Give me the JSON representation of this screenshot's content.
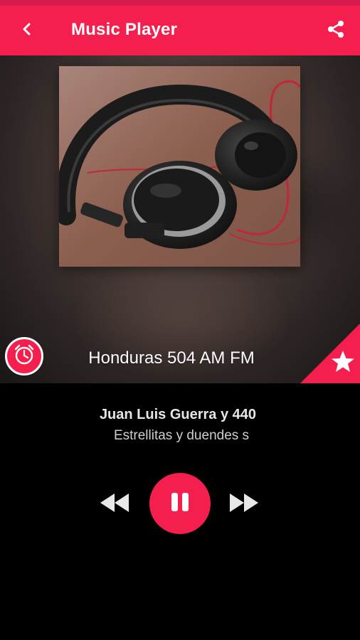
{
  "app_bar": {
    "title": "Music Player",
    "back_icon": "arrow-back-icon",
    "share_icon": "share-icon"
  },
  "station": {
    "name": "Honduras 504 AM FM",
    "artwork": "headphones-photo"
  },
  "now_playing": {
    "artist": "Juan Luis Guerra y 440",
    "track": "Estrellitas y duendes s"
  },
  "controls": {
    "rewind_icon": "rewind-icon",
    "pause_icon": "pause-icon",
    "forward_icon": "fast-forward-icon",
    "alarm_icon": "alarm-clock-icon",
    "favorite_icon": "star-icon"
  },
  "colors": {
    "accent": "#f51f4d",
    "background": "#000000",
    "text_primary": "#ffffff",
    "text_secondary": "#cfcfcf"
  }
}
